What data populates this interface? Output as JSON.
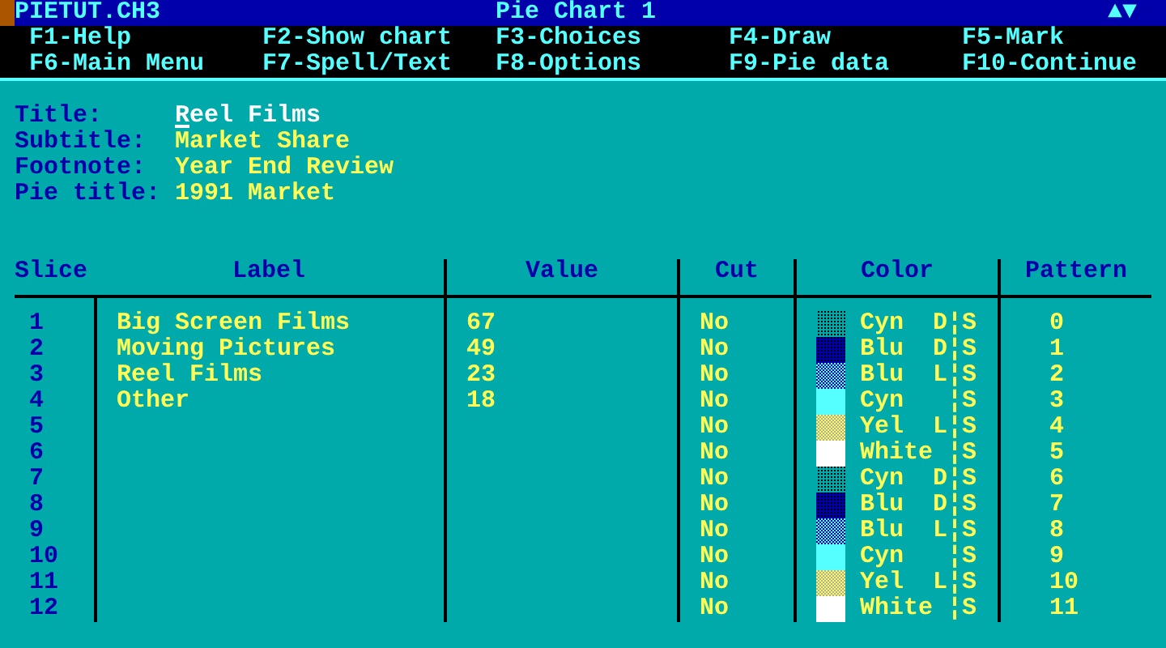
{
  "window": {
    "file": "PIETUT.CH3",
    "title": "Pie Chart 1",
    "scroll_indicator": "▲▼"
  },
  "function_keys": [
    "F1-Help",
    "F2-Show chart",
    "F3-Choices",
    "F4-Draw",
    "F5-Mark",
    "F6-Main Menu",
    "F7-Spell/Text",
    "F8-Options",
    "F9-Pie data",
    "F10-Continue"
  ],
  "fields": [
    {
      "label": "Title:",
      "value": "Reel Films",
      "focused": true
    },
    {
      "label": "Subtitle:",
      "value": "Market Share",
      "focused": false
    },
    {
      "label": "Footnote:",
      "value": "Year End Review",
      "focused": false
    },
    {
      "label": "Pie title:",
      "value": "1991 Market",
      "focused": false
    }
  ],
  "table": {
    "columns": [
      "Slice",
      "Label",
      "Value",
      "Cut",
      "Color",
      "Pattern"
    ],
    "rows": [
      {
        "slice": "1",
        "label": "Big Screen Films",
        "value": "67",
        "cut": "No",
        "color_name": "Cyn  D¦S",
        "color": "#00aaaa",
        "kind": "dark",
        "pattern": "0"
      },
      {
        "slice": "2",
        "label": "Moving Pictures",
        "value": "49",
        "cut": "No",
        "color_name": "Blu  D¦S",
        "color": "#0000aa",
        "kind": "dark",
        "pattern": "1"
      },
      {
        "slice": "3",
        "label": "Reel Films",
        "value": "23",
        "cut": "No",
        "color_name": "Blu  L¦S",
        "color": "#0000aa",
        "kind": "light",
        "pattern": "2"
      },
      {
        "slice": "4",
        "label": "Other",
        "value": "18",
        "cut": "No",
        "color_name": "Cyn   ¦S",
        "color": "#55ffff",
        "kind": "solid",
        "pattern": "3"
      },
      {
        "slice": "5",
        "cut": "No",
        "color_name": "Yel  L¦S",
        "color": "#ffff55",
        "kind": "light",
        "pattern": "4"
      },
      {
        "slice": "6",
        "cut": "No",
        "color_name": "White ¦S",
        "color": "#ffffff",
        "kind": "solid",
        "pattern": "5"
      },
      {
        "slice": "7",
        "cut": "No",
        "color_name": "Cyn  D¦S",
        "color": "#00aaaa",
        "kind": "dark",
        "pattern": "6"
      },
      {
        "slice": "8",
        "cut": "No",
        "color_name": "Blu  D¦S",
        "color": "#0000aa",
        "kind": "dark",
        "pattern": "7"
      },
      {
        "slice": "9",
        "cut": "No",
        "color_name": "Blu  L¦S",
        "color": "#0000aa",
        "kind": "light",
        "pattern": "8"
      },
      {
        "slice": "10",
        "cut": "No",
        "color_name": "Cyn   ¦S",
        "color": "#55ffff",
        "kind": "solid",
        "pattern": "9"
      },
      {
        "slice": "11",
        "cut": "No",
        "color_name": "Yel  L¦S",
        "color": "#ffff55",
        "kind": "light",
        "pattern": "10"
      },
      {
        "slice": "12",
        "cut": "No",
        "color_name": "White ¦S",
        "color": "#ffffff",
        "kind": "solid",
        "pattern": "11"
      }
    ]
  }
}
